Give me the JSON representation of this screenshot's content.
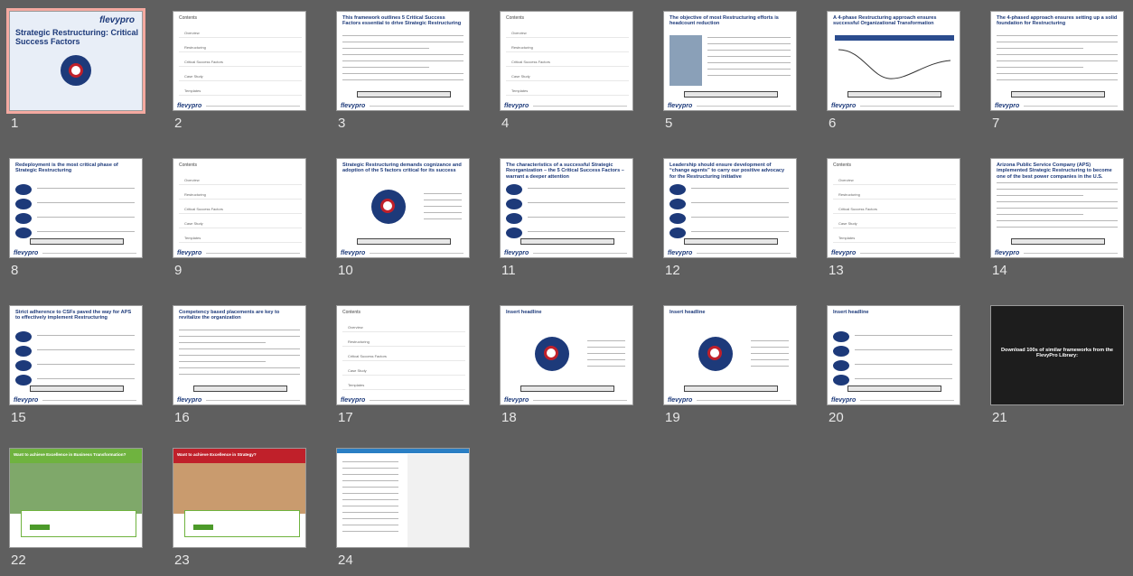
{
  "brand": {
    "logo_text": "flevypro",
    "accent": "#1d3a7a",
    "selected_outline": "#f4a9a0"
  },
  "slides": [
    {
      "num": "1",
      "kind": "cover",
      "title": "Strategic Restructuring: Critical Success Factors"
    },
    {
      "num": "2",
      "kind": "contents",
      "heading": "Contents"
    },
    {
      "num": "3",
      "kind": "text",
      "title": "This framework outlines 5 Critical Success Factors essential to drive Strategic Restructuring"
    },
    {
      "num": "4",
      "kind": "contents",
      "heading": "Contents"
    },
    {
      "num": "5",
      "kind": "photo-text",
      "title": "The objective of most Restructuring efforts is headcount reduction"
    },
    {
      "num": "6",
      "kind": "chart",
      "title": "A 4-phase Restructuring approach ensures successful Organizational Transformation"
    },
    {
      "num": "7",
      "kind": "text",
      "title": "The 4-phased approach ensures setting up a solid foundation for Restructuring"
    },
    {
      "num": "8",
      "kind": "list",
      "title": "Redeployment is the most critical phase of Strategic Restructuring"
    },
    {
      "num": "9",
      "kind": "contents",
      "heading": "Contents"
    },
    {
      "num": "10",
      "kind": "wheel",
      "title": "Strategic Restructuring demands cognizance and adoption of the 5 factors critical for its success"
    },
    {
      "num": "11",
      "kind": "list",
      "title": "The characteristics of a successful Strategic Reorganization – the 5 Critical Success Factors – warrant a deeper attention"
    },
    {
      "num": "12",
      "kind": "list",
      "title": "Leadership should ensure development of “change agents” to carry our positive advocacy for the Restructuring initiative"
    },
    {
      "num": "13",
      "kind": "contents",
      "heading": "Contents"
    },
    {
      "num": "14",
      "kind": "case",
      "title": "Arizona Public Service Company (APS) implemented Strategic Restructuring to become one of the best power companies in the U.S."
    },
    {
      "num": "15",
      "kind": "list",
      "title": "Strict adherence to CSFs paved the way for APS to effectively implement Restructuring"
    },
    {
      "num": "16",
      "kind": "text",
      "title": "Competency based placements are key to revitalize the organization"
    },
    {
      "num": "17",
      "kind": "contents",
      "heading": "Contents"
    },
    {
      "num": "18",
      "kind": "wheel",
      "title": "Insert headline"
    },
    {
      "num": "19",
      "kind": "wheel",
      "title": "Insert headline"
    },
    {
      "num": "20",
      "kind": "list",
      "title": "Insert headline"
    },
    {
      "num": "21",
      "kind": "library",
      "title": "Download 100s of similar frameworks from the FlevyPro Library:"
    },
    {
      "num": "22",
      "kind": "green",
      "title": "Want to achieve Excellence in Business Transformation?"
    },
    {
      "num": "23",
      "kind": "red",
      "title": "Want to achieve Excellence in Strategy?"
    },
    {
      "num": "24",
      "kind": "about",
      "title": ""
    }
  ],
  "contents_items": [
    "Overview",
    "Restructuring",
    "Critical Success Factors",
    "Case Study",
    "Templates"
  ]
}
